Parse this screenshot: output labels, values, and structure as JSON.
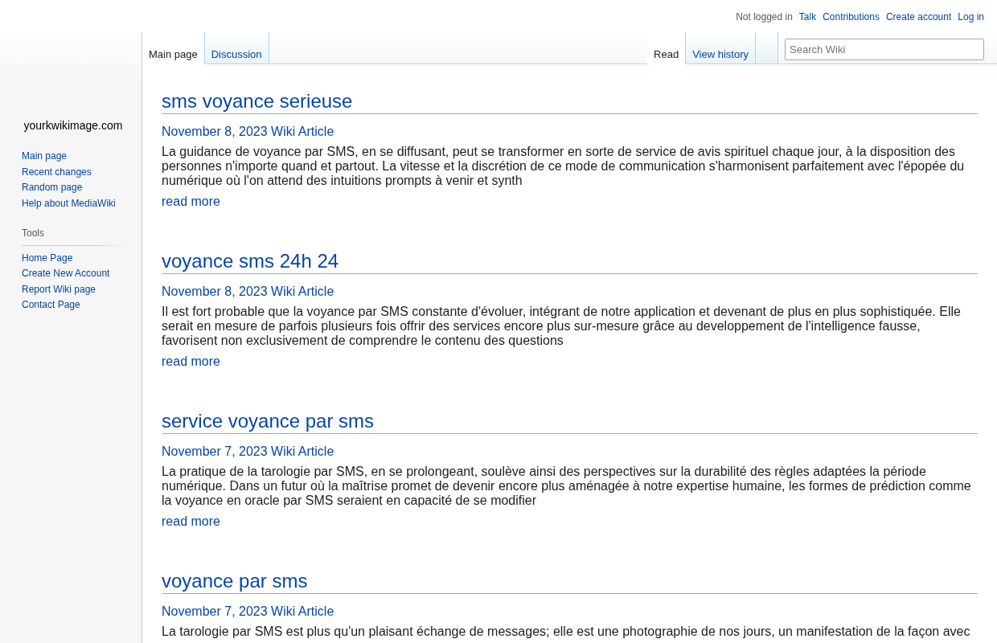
{
  "site_name": "yourkwikimage.com",
  "personal_tools": {
    "status": "Not logged in",
    "links": [
      "Talk",
      "Contributions",
      "Create account",
      "Log in"
    ]
  },
  "left_tabs": [
    {
      "label": "Main page",
      "selected": true
    },
    {
      "label": "Discussion",
      "selected": false
    }
  ],
  "right_tabs": [
    {
      "label": "Read",
      "selected": true
    },
    {
      "label": "View history",
      "selected": false
    }
  ],
  "search": {
    "placeholder": "Search Wiki"
  },
  "navigation": [
    "Main page",
    "Recent changes",
    "Random page",
    "Help about MediaWiki"
  ],
  "tools": {
    "heading": "Tools",
    "items": [
      "Home Page",
      "Create New Account",
      "Report Wiki page",
      "Contact Page"
    ]
  },
  "articles": [
    {
      "title": "sms voyance serieuse",
      "meta": "November 8, 2023 Wiki Article",
      "excerpt": "La guidance de voyance par SMS, en se diffusant, peut se transformer en sorte de service de avis spirituel chaque jour, à la disposition des personnes n'importe quand et partout. La vitesse et la discrétion de ce mode de communication s'harmonisent parfaitement avec l'épopée du numérique où l'on attend des intuitions prompts à venir et synth",
      "more": "read more"
    },
    {
      "title": "voyance sms 24h 24",
      "meta": "November 8, 2023 Wiki Article",
      "excerpt": "Il est fort probable que la voyance par SMS constante d'évoluer, intégrant de notre application et devenant de plus en plus sophistiquée. Elle serait en mesure de parfois plusieurs fois offrir des services encore plus sur-mesure grâce au developpement de l'intelligence fausse, favorisent non exclusivement de comprendre le contenu des questions",
      "more": "read more"
    },
    {
      "title": "service voyance par sms",
      "meta": "November 7, 2023 Wiki Article",
      "excerpt": "La pratique de la tarologie par SMS, en se prolongeant, soulève ainsi des perspectives sur la durabilité des règles adaptées la période numérique. Dans un futur où la maîtrise promet de devenir encore plus aménagée à notre expertise humaine, les formes de prédiction comme la voyance en oracle par SMS seraient en capacité de se modifier",
      "more": "read more"
    },
    {
      "title": "voyance par sms",
      "meta": "November 7, 2023 Wiki Article",
      "excerpt": "La tarologie par SMS est plus qu'un plaisant échange de messages; elle est une photographie de nos jours, un manifestation de la façon avec"
    }
  ]
}
